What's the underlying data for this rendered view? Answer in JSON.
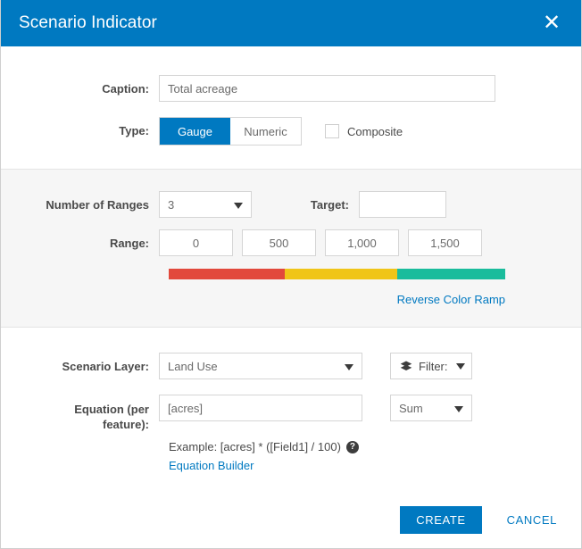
{
  "header": {
    "title": "Scenario Indicator",
    "close_icon": "close-icon",
    "close_glyph": "✕",
    "background": "#0079c1"
  },
  "form": {
    "caption": {
      "label": "Caption:",
      "value": "Total acreage",
      "placeholder": ""
    },
    "type": {
      "label": "Type:",
      "options": [
        "Gauge",
        "Numeric"
      ],
      "selected": "Gauge",
      "composite_label": "Composite",
      "composite_checked": false
    },
    "ranges": {
      "count_label": "Number of Ranges",
      "count_value": "3",
      "target_label": "Target:",
      "target_value": "",
      "range_label": "Range:",
      "range_values": [
        "0",
        "500",
        "1,000",
        "1,500"
      ],
      "ramp_colors": [
        "#e2493c",
        "#f0c518",
        "#1abc9c"
      ],
      "ramp_stops": [
        34.5,
        33.5,
        32.0
      ],
      "reverse_link": "Reverse Color Ramp"
    },
    "scenario_layer": {
      "label": "Scenario Layer:",
      "value": "Land Use",
      "filter_label": "Filter:",
      "filter_icon": "layers-icon"
    },
    "equation": {
      "label_line1": "Equation (per",
      "label_line2": "feature):",
      "value": "[acres]",
      "aggregate": "Sum",
      "example_text": "Example: [acres] * ([Field1] / 100)",
      "help_glyph": "?",
      "builder_link": "Equation Builder"
    }
  },
  "footer": {
    "create_label": "CREATE",
    "cancel_label": "CANCEL",
    "accent": "#0079c1"
  }
}
